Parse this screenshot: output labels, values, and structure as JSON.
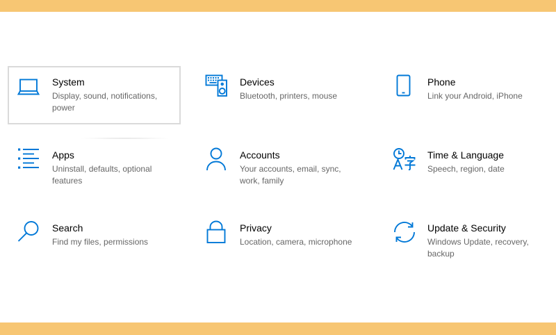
{
  "theme": {
    "accent_color": "#0078D7",
    "frame_color": "#F7C673",
    "title_color": "#000000",
    "description_color": "#666666"
  },
  "tiles": [
    {
      "title": "System",
      "description": "Display, sound, notifications,\npower",
      "icon": "laptop-icon",
      "highlighted": true
    },
    {
      "title": "Devices",
      "description": "Bluetooth, printers, mouse",
      "icon": "devices-icon",
      "highlighted": false
    },
    {
      "title": "Phone",
      "description": "Link your Android, iPhone",
      "icon": "phone-icon",
      "highlighted": false
    },
    {
      "title": "Apps",
      "description": "Uninstall, defaults, optional\nfeatures",
      "icon": "apps-list-icon",
      "highlighted": false
    },
    {
      "title": "Accounts",
      "description": "Your accounts, email, sync,\nwork, family",
      "icon": "person-icon",
      "highlighted": false
    },
    {
      "title": "Time & Language",
      "description": "Speech, region, date",
      "icon": "time-language-icon",
      "highlighted": false
    },
    {
      "title": "Search",
      "description": "Find my files, permissions",
      "icon": "search-icon",
      "highlighted": false
    },
    {
      "title": "Privacy",
      "description": "Location, camera, microphone",
      "icon": "lock-icon",
      "highlighted": false
    },
    {
      "title": "Update & Security",
      "description": "Windows Update, recovery,\nbackup",
      "icon": "sync-arrows-icon",
      "highlighted": false
    }
  ]
}
